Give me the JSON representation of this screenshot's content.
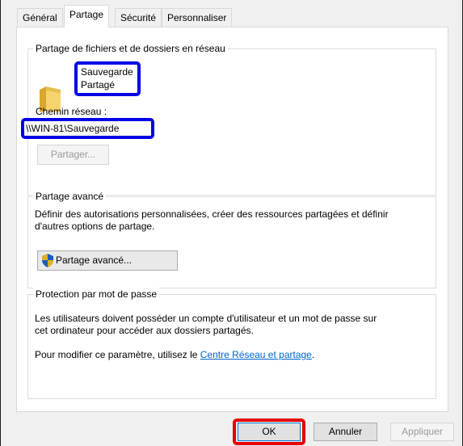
{
  "tabs": [
    {
      "label": "Général"
    },
    {
      "label": "Partage"
    },
    {
      "label": "Sécurité"
    },
    {
      "label": "Personnaliser"
    }
  ],
  "network_sharing": {
    "title": "Partage de fichiers et de dossiers en réseau",
    "folder_name": "Sauvegarde",
    "status": "Partagé",
    "path_label": "Chemin réseau :",
    "path_value": "\\\\WIN-81\\Sauvegarde",
    "share_button": "Partager..."
  },
  "advanced_sharing": {
    "title": "Partage avancé",
    "description_line1": "Définir des autorisations personnalisées, créer des ressources partagées et définir",
    "description_line2": "d'autres options de partage.",
    "button": "Partage avancé..."
  },
  "password_protection": {
    "title": "Protection par mot de passe",
    "line1": "Les utilisateurs doivent posséder un compte d'utilisateur et un mot de passe sur",
    "line2": "cet ordinateur pour accéder aux dossiers partagés.",
    "modify_prefix": "Pour modifier ce paramètre, utilisez le ",
    "modify_link": "Centre Réseau et partage",
    "modify_suffix": "."
  },
  "footer": {
    "ok": "OK",
    "cancel": "Annuler",
    "apply": "Appliquer"
  },
  "colors": {
    "highlight_blue": "#0000e6",
    "highlight_red": "#e60000",
    "link": "#0066cc"
  }
}
